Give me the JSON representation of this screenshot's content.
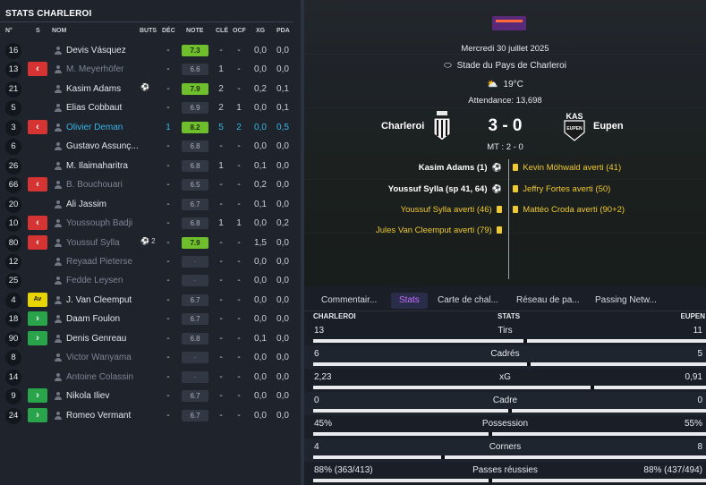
{
  "left": {
    "title": "STATS CHARLEROI",
    "headers": {
      "num": "N°",
      "s": "S",
      "name": "NOM",
      "buts": "BUTS",
      "dec": "DÉC",
      "note": "NOTE",
      "cle": "CLÉ",
      "ocf": "OCF",
      "xg": "XG",
      "pda": "PDA"
    },
    "players": [
      {
        "num": "16",
        "sub": "",
        "name": "Devis Vásquez",
        "dim": false,
        "buts": "",
        "dec": "-",
        "note": "7.3",
        "note_style": "good",
        "cle": "-",
        "ocf": "-",
        "xg": "0,0",
        "pda": "0,0"
      },
      {
        "num": "13",
        "sub": "out",
        "sub_label": "‹",
        "name": "M. Meyerhöfer",
        "dim": true,
        "buts": "",
        "dec": "-",
        "note": "6.6",
        "note_style": "",
        "cle": "1",
        "ocf": "-",
        "xg": "0,0",
        "pda": "0,0"
      },
      {
        "num": "21",
        "sub": "",
        "name": "Kasim Adams",
        "dim": false,
        "buts": "⚽",
        "dec": "-",
        "note": "7.9",
        "note_style": "good",
        "cle": "2",
        "ocf": "-",
        "xg": "0,2",
        "pda": "0,1"
      },
      {
        "num": "5",
        "sub": "",
        "name": "Elias Cobbaut",
        "dim": false,
        "buts": "",
        "dec": "-",
        "note": "6.9",
        "note_style": "",
        "cle": "2",
        "ocf": "1",
        "xg": "0,0",
        "pda": "0,1"
      },
      {
        "num": "3",
        "sub": "out",
        "sub_label": "‹",
        "name": "Olivier Deman",
        "dim": false,
        "sel": true,
        "buts": "",
        "dec": "1",
        "note": "8.2",
        "note_style": "good",
        "cle": "5",
        "ocf": "2",
        "xg": "0,0",
        "pda": "0,5"
      },
      {
        "num": "6",
        "sub": "",
        "name": "Gustavo Assunç...",
        "dim": false,
        "buts": "",
        "dec": "-",
        "note": "6.8",
        "note_style": "",
        "cle": "-",
        "ocf": "-",
        "xg": "0,0",
        "pda": "0,0"
      },
      {
        "num": "26",
        "sub": "",
        "name": "M. Ilaimaharitra",
        "dim": false,
        "buts": "",
        "dec": "-",
        "note": "6.8",
        "note_style": "",
        "cle": "1",
        "ocf": "-",
        "xg": "0,1",
        "pda": "0,0"
      },
      {
        "num": "66",
        "sub": "out",
        "sub_label": "‹",
        "name": "B. Bouchouari",
        "dim": true,
        "buts": "",
        "dec": "-",
        "note": "6.5",
        "note_style": "",
        "cle": "-",
        "ocf": "-",
        "xg": "0,2",
        "pda": "0,0"
      },
      {
        "num": "20",
        "sub": "",
        "name": "Ali Jassim",
        "dim": false,
        "buts": "",
        "dec": "-",
        "note": "6.7",
        "note_style": "",
        "cle": "-",
        "ocf": "-",
        "xg": "0,1",
        "pda": "0,0"
      },
      {
        "num": "10",
        "sub": "out",
        "sub_label": "‹",
        "name": "Youssouph Badji",
        "dim": true,
        "buts": "",
        "dec": "-",
        "note": "6.8",
        "note_style": "",
        "cle": "1",
        "ocf": "1",
        "xg": "0,0",
        "pda": "0,2"
      },
      {
        "num": "80",
        "sub": "out",
        "sub_label": "‹",
        "name": "Youssuf Sylla",
        "dim": true,
        "buts": "⚽ 2",
        "dec": "-",
        "note": "7.9",
        "note_style": "good",
        "cle": "-",
        "ocf": "-",
        "xg": "1,5",
        "pda": "0,0"
      },
      {
        "num": "12",
        "sub": "",
        "name": "Reyaad Pieterse",
        "dim": true,
        "buts": "",
        "dec": "-",
        "note": "-",
        "note_style": "dim",
        "cle": "-",
        "ocf": "-",
        "xg": "0,0",
        "pda": "0,0"
      },
      {
        "num": "25",
        "sub": "",
        "name": "Fedde Leysen",
        "dim": true,
        "buts": "",
        "dec": "-",
        "note": "-",
        "note_style": "dim",
        "cle": "-",
        "ocf": "-",
        "xg": "0,0",
        "pda": "0,0"
      },
      {
        "num": "4",
        "sub": "av",
        "sub_label": "Av",
        "name": "J. Van Cleemput",
        "dim": false,
        "buts": "",
        "dec": "-",
        "note": "6.7",
        "note_style": "",
        "cle": "-",
        "ocf": "-",
        "xg": "0,0",
        "pda": "0,0"
      },
      {
        "num": "18",
        "sub": "in",
        "sub_label": "›",
        "name": "Daam Foulon",
        "dim": false,
        "buts": "",
        "dec": "-",
        "note": "6.7",
        "note_style": "",
        "cle": "-",
        "ocf": "-",
        "xg": "0,0",
        "pda": "0,0"
      },
      {
        "num": "90",
        "sub": "in",
        "sub_label": "›",
        "name": "Denis Genreau",
        "dim": false,
        "buts": "",
        "dec": "-",
        "note": "6.8",
        "note_style": "",
        "cle": "-",
        "ocf": "-",
        "xg": "0,1",
        "pda": "0,0"
      },
      {
        "num": "8",
        "sub": "",
        "name": "Victor Wanyama",
        "dim": true,
        "buts": "",
        "dec": "-",
        "note": "-",
        "note_style": "dim",
        "cle": "-",
        "ocf": "-",
        "xg": "0,0",
        "pda": "0,0"
      },
      {
        "num": "14",
        "sub": "",
        "name": "Antoine Colassin",
        "dim": true,
        "buts": "",
        "dec": "-",
        "note": "-",
        "note_style": "dim",
        "cle": "-",
        "ocf": "-",
        "xg": "0,0",
        "pda": "0,0"
      },
      {
        "num": "9",
        "sub": "in",
        "sub_label": "›",
        "name": "Nikola Iliev",
        "dim": false,
        "buts": "",
        "dec": "-",
        "note": "6.7",
        "note_style": "",
        "cle": "-",
        "ocf": "-",
        "xg": "0,0",
        "pda": "0,0"
      },
      {
        "num": "24",
        "sub": "in",
        "sub_label": "›",
        "name": "Romeo Vermant",
        "dim": false,
        "buts": "",
        "dec": "-",
        "note": "6.7",
        "note_style": "",
        "cle": "-",
        "ocf": "-",
        "xg": "0,0",
        "pda": "0,0"
      }
    ]
  },
  "match": {
    "date": "Mercredi 30 juillet 2025",
    "stadium": "Stade du Pays de Charleroi",
    "temperature": "19°C",
    "attendance": "Attendance: 13,698",
    "home": "Charleroi",
    "away": "Eupen",
    "away_crest_text": "KAS",
    "away_crest_sub": "EUPEN",
    "score": "3 - 0",
    "halftime": "MT : 2 - 0",
    "events_left": [
      {
        "text": "Kasim Adams (1)",
        "type": "goal"
      },
      {
        "text": "Youssuf Sylla (sp 41, 64)",
        "type": "goal"
      },
      {
        "text": "Youssuf Sylla averti (46)",
        "type": "card"
      },
      {
        "text": "Jules Van Cleemput averti (79)",
        "type": "card"
      }
    ],
    "events_right": [
      {
        "text": "Kevin Möhwald averti (41)",
        "type": "card"
      },
      {
        "text": "Jeffry Fortes averti (50)",
        "type": "card"
      },
      {
        "text": "Mattéo Croda averti (90+2)",
        "type": "card"
      }
    ]
  },
  "tabs": [
    {
      "label": "Commentair...",
      "active": false
    },
    {
      "label": "Stats",
      "active": true
    },
    {
      "label": "Carte de chal...",
      "active": false
    },
    {
      "label": "Réseau de pa...",
      "active": false
    },
    {
      "label": "Passing Netw...",
      "active": false
    }
  ],
  "stats": {
    "header_home": "CHARLEROI",
    "header_title": "STATS",
    "header_away": "EUPEN",
    "rows": [
      {
        "label": "Tirs",
        "home": "13",
        "away": "11",
        "home_frac": 0.54
      },
      {
        "label": "Cadrés",
        "home": "6",
        "away": "5",
        "home_frac": 0.55
      },
      {
        "label": "xG",
        "home": "2,23",
        "away": "0,91",
        "home_frac": 0.71
      },
      {
        "label": "Cadre",
        "home": "0",
        "away": "0",
        "home_frac": 0.5
      },
      {
        "label": "Possession",
        "home": "45%",
        "away": "55%",
        "home_frac": 0.45
      },
      {
        "label": "Corners",
        "home": "4",
        "away": "8",
        "home_frac": 0.33
      },
      {
        "label": "Passes réussies",
        "home": "88% (363/413)",
        "away": "88% (437/494)",
        "home_frac": 0.45
      }
    ]
  },
  "colors": {
    "good_note": "#6fbf2c",
    "sub_out": "#d63333",
    "sub_in": "#2aa44a",
    "card": "#f0c830",
    "selected": "#39b6e6",
    "tab_active": "#c66cff"
  }
}
